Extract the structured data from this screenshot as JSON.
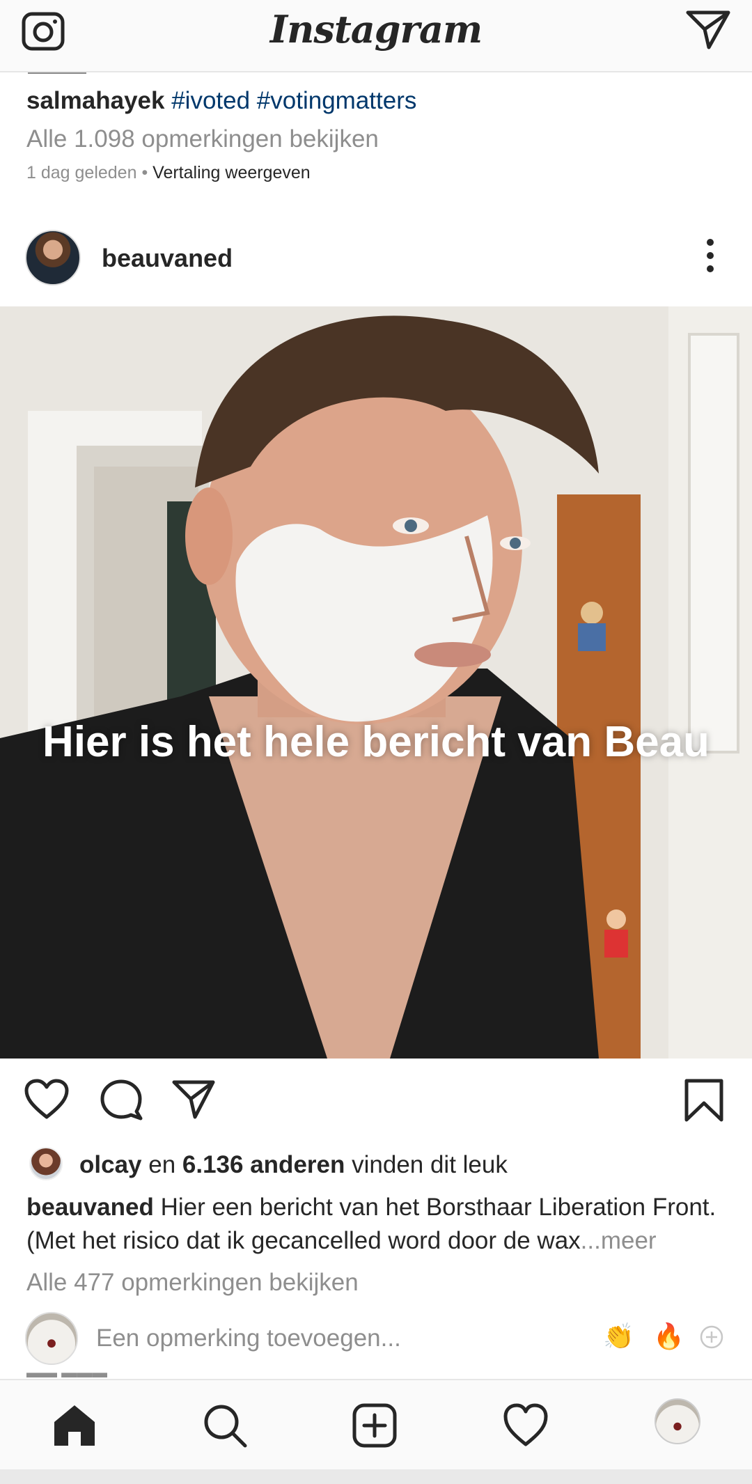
{
  "topbar": {
    "logo": "Instagram",
    "camera_icon": "camera-icon",
    "direct_icon": "paper-plane-icon"
  },
  "previous_post": {
    "username": "salmahayek",
    "hashtags": "#ivoted #votingmatters",
    "view_all_comments": "Alle 1.098 opmerkingen bekijken",
    "time": "1 dag geleden",
    "separator": "•",
    "translate": "Vertaling weergeven"
  },
  "post": {
    "username": "beauvaned",
    "more_icon": "more-vertical-icon",
    "photo_overlay_text": "Hier is het hele bericht van Beau",
    "liked_by_user": "olcay",
    "liked_by_join": "en",
    "liked_by_others": "6.136 anderen",
    "liked_by_suffix": "vinden dit leuk",
    "caption_user": "beauvaned",
    "caption_text": "Hier een bericht van het Borsthaar Liberation Front. (Met het risico dat ik gecancelled word door de wax",
    "caption_more": "...meer",
    "view_all_comments": "Alle 477 opmerkingen bekijken",
    "comment_placeholder": "Een opmerking toevoegen...",
    "quick_emojis": [
      "👏",
      "🔥"
    ],
    "colors": {
      "accent_link": "#00376b",
      "muted": "#8e8e8e",
      "text": "#262626"
    }
  },
  "bottom_nav": {
    "items": [
      "home-icon",
      "search-icon",
      "add-post-icon",
      "activity-heart-icon",
      "profile-avatar"
    ]
  }
}
